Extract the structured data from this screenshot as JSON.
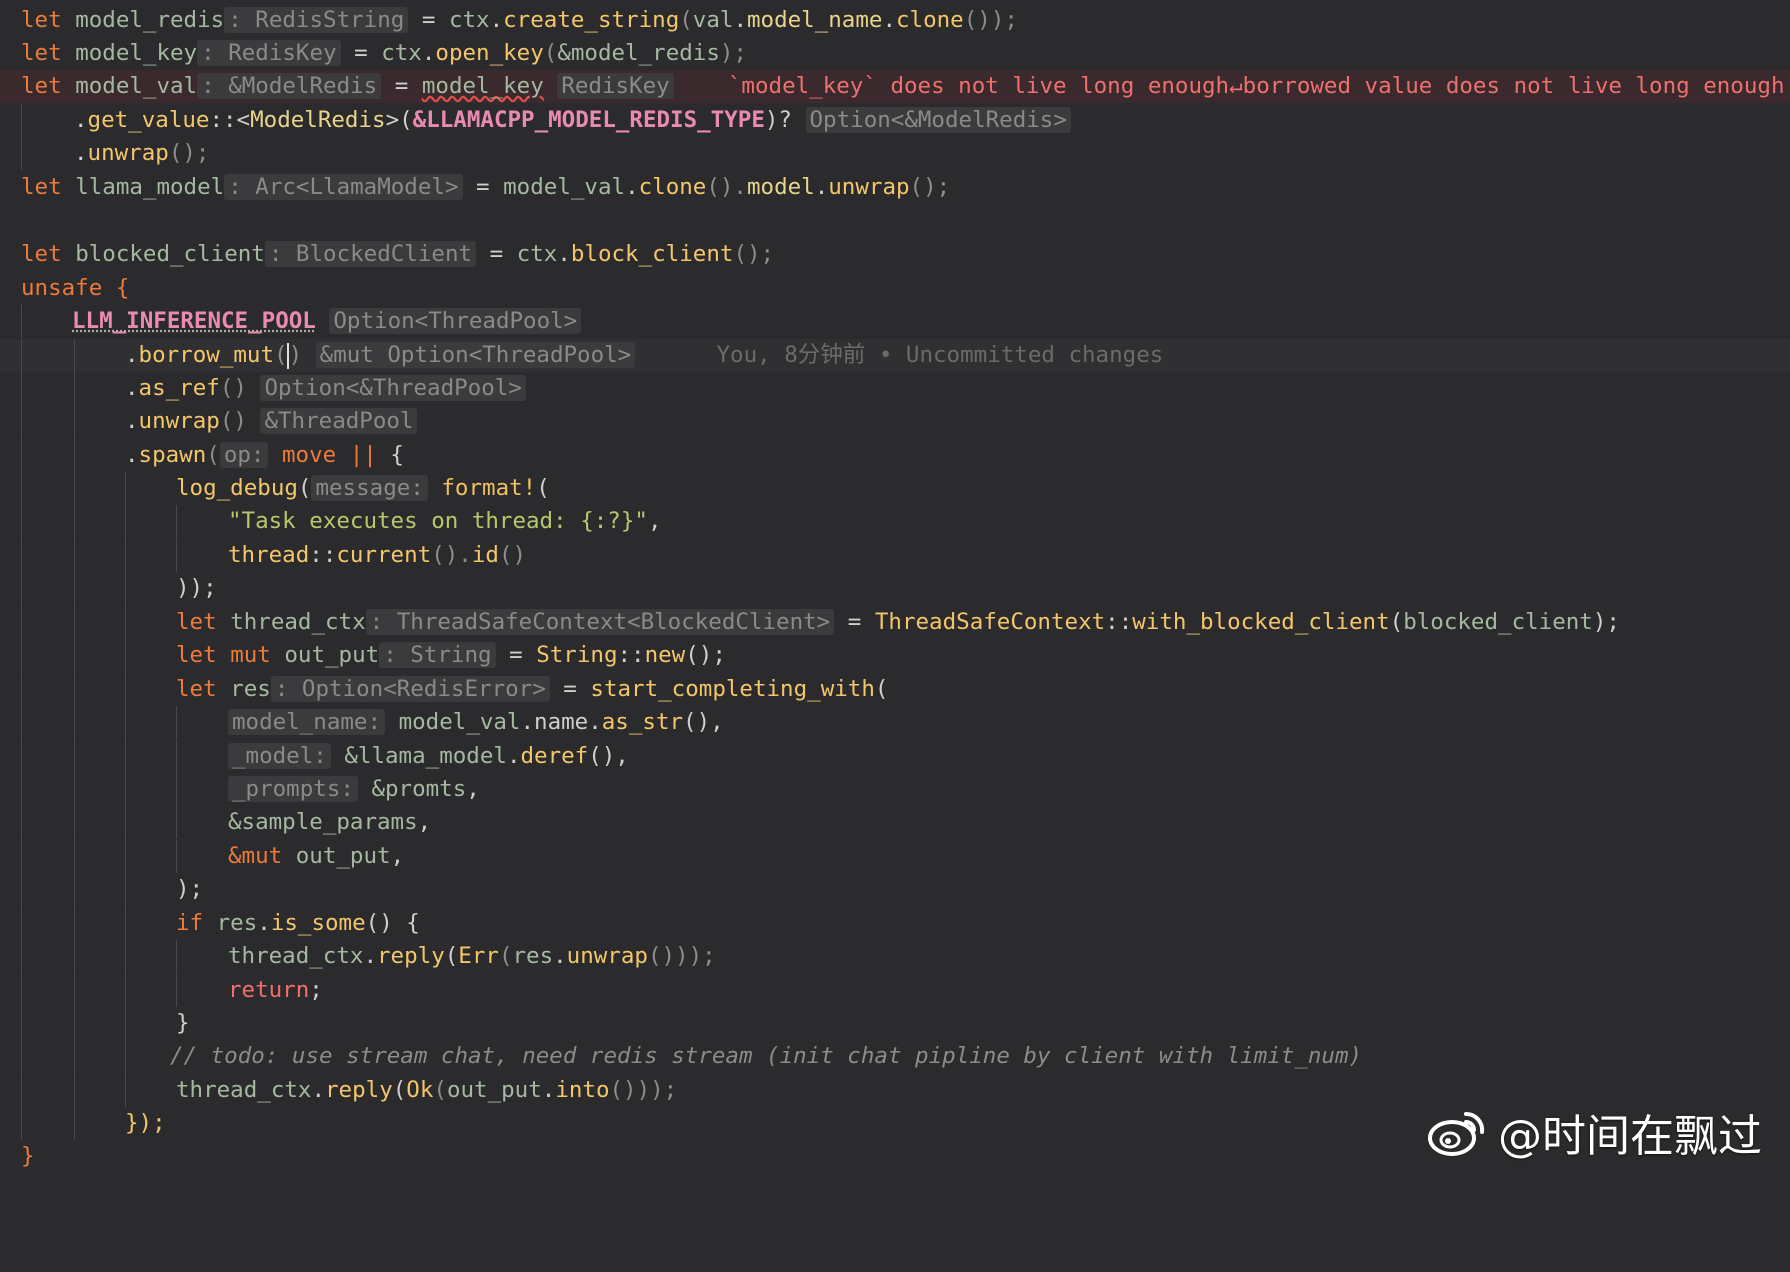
{
  "lines": {
    "l1": {
      "kw": "let",
      "name": "model_redis",
      "hint": ": RedisString",
      "eq": " = ",
      "v": "ctx",
      "dot": ".",
      "f": "create_string",
      "p1": "(",
      "a": "val",
      "dot2": ".",
      "field": "model_name",
      "dot3": ".",
      "f2": "clone",
      "p2": "());"
    },
    "l2": {
      "kw": "let",
      "name": "model_key",
      "hint": ": RedisKey",
      "eq": " = ",
      "v": "ctx",
      "dot": ".",
      "f": "open_key",
      "p1": "(",
      "a": "&model_redis",
      "p2": ");"
    },
    "l3": {
      "kw": "let",
      "name": "model_val",
      "hint": ": &ModelRedis",
      "eq": " = ",
      "v": "model_key",
      "hint2": "RedisKey",
      "err": "`model_key` does not live long enough↵borrowed value does not live long enough"
    },
    "l4": {
      "dot": ".",
      "f": "get_value",
      "sep": "::<",
      "t": "ModelRedis",
      "p1": ">(",
      "s": "&LLAMACPP_MODEL_REDIS_TYPE",
      "p2": ")?",
      "hint": "Option<&ModelRedis>"
    },
    "l5": {
      "dot": ".",
      "f": "unwrap",
      "p": "();"
    },
    "l6": {
      "kw": "let",
      "name": "llama_model",
      "hint": ": Arc<LlamaModel>",
      "eq": " = ",
      "v": "model_val",
      "dot": ".",
      "f": "clone",
      "p1": "().",
      "field": "model",
      "dot2": ".",
      "f2": "unwrap",
      "p2": "();"
    },
    "l8": {
      "kw": "let",
      "name": "blocked_client",
      "hint": ": BlockedClient",
      "eq": " = ",
      "v": "ctx",
      "dot": ".",
      "f": "block_client",
      "p": "();"
    },
    "l9": {
      "kw": "unsafe",
      "p": " {"
    },
    "l10": {
      "s": "LLM_INFERENCE_POOL",
      "hint": "Option<ThreadPool>"
    },
    "l11": {
      "dot": ".",
      "f": "borrow_mut",
      "p1": "(",
      "p2": ")",
      "hint": "&mut Option<ThreadPool>",
      "blame": "You, 8分钟前 • Uncommitted changes"
    },
    "l12": {
      "dot": ".",
      "f": "as_ref",
      "p": "()",
      "hint": "Option<&ThreadPool>"
    },
    "l13": {
      "dot": ".",
      "f": "unwrap",
      "p": "()",
      "hint": "&ThreadPool"
    },
    "l14": {
      "dot": ".",
      "f": "spawn",
      "p1": "(",
      "hint": "op:",
      "kw": "move",
      "pipes": " ||",
      "p2": " {"
    },
    "l15": {
      "f": "log_debug",
      "p1": "(",
      "hint": "message:",
      "m": "format!",
      "p2": "("
    },
    "l16": {
      "s": "\"Task executes on thread: {:?}\"",
      "p": ","
    },
    "l17": {
      "t": "thread",
      "sep": "::",
      "f": "current",
      "p1": "().",
      "f2": "id",
      "p2": "()"
    },
    "l18": {
      "p": "));"
    },
    "l19": {
      "kw": "let",
      "name": "thread_ctx",
      "hint": ": ThreadSafeContext<BlockedClient>",
      "eq": " = ",
      "t": "ThreadSafeContext",
      "sep": "::",
      "f": "with_blocked_client",
      "p1": "(",
      "a": "blocked_client",
      "p2": ");"
    },
    "l20": {
      "kw": "let",
      "kw2": "mut",
      "name": "out_put",
      "hint": ": String",
      "eq": " = ",
      "t": "String",
      "sep": "::",
      "f": "new",
      "p": "();"
    },
    "l21": {
      "kw": "let",
      "name": "res",
      "hint": ": Option<RedisError>",
      "eq": " = ",
      "f": "start_completing_with",
      "p": "("
    },
    "l22": {
      "hint": "model_name:",
      "v": "model_val",
      "dot": ".",
      "field": "name",
      "dot2": ".",
      "f": "as_str",
      "p": "(),"
    },
    "l23": {
      "hint": "_model:",
      "v": "&llama_model",
      "dot": ".",
      "f": "deref",
      "p": "(),"
    },
    "l24": {
      "hint": "_prompts:",
      "v": "&promts",
      "p": ","
    },
    "l25": {
      "v": "&sample_params",
      "p": ","
    },
    "l26": {
      "kw": "&mut",
      "v": " out_put",
      "p": ","
    },
    "l27": {
      "p": ");"
    },
    "l28": {
      "kw": "if",
      "v": " res",
      "dot": ".",
      "f": "is_some",
      "p": "() {"
    },
    "l29": {
      "v": "thread_ctx",
      "dot": ".",
      "f": "reply",
      "p1": "(",
      "t": "Err",
      "p2": "(",
      "a": "res",
      "dot2": ".",
      "f2": "unwrap",
      "p3": "()));"
    },
    "l30": {
      "kw": "return",
      "p": ";"
    },
    "l31": {
      "p": "}"
    },
    "l32": {
      "c": "// todo: use stream chat, need redis stream (init chat pipline by client with limit_num)"
    },
    "l33": {
      "v": "thread_ctx",
      "dot": ".",
      "f": "reply",
      "p1": "(",
      "t": "Ok",
      "p2": "(",
      "a": "out_put",
      "dot2": ".",
      "f2": "into",
      "p3": "()));"
    },
    "l34": {
      "p": "});"
    },
    "l35": {
      "p": "}"
    }
  },
  "watermark": {
    "text": "@时间在飘过",
    "icon": "weibo-logo-icon"
  },
  "colors": {
    "background": "#2b2b2d",
    "keyword": "#ec7a3a",
    "function": "#f4c66a",
    "error": "#ef6f6f",
    "string": "#b5c96c",
    "static": "#e98baf"
  }
}
